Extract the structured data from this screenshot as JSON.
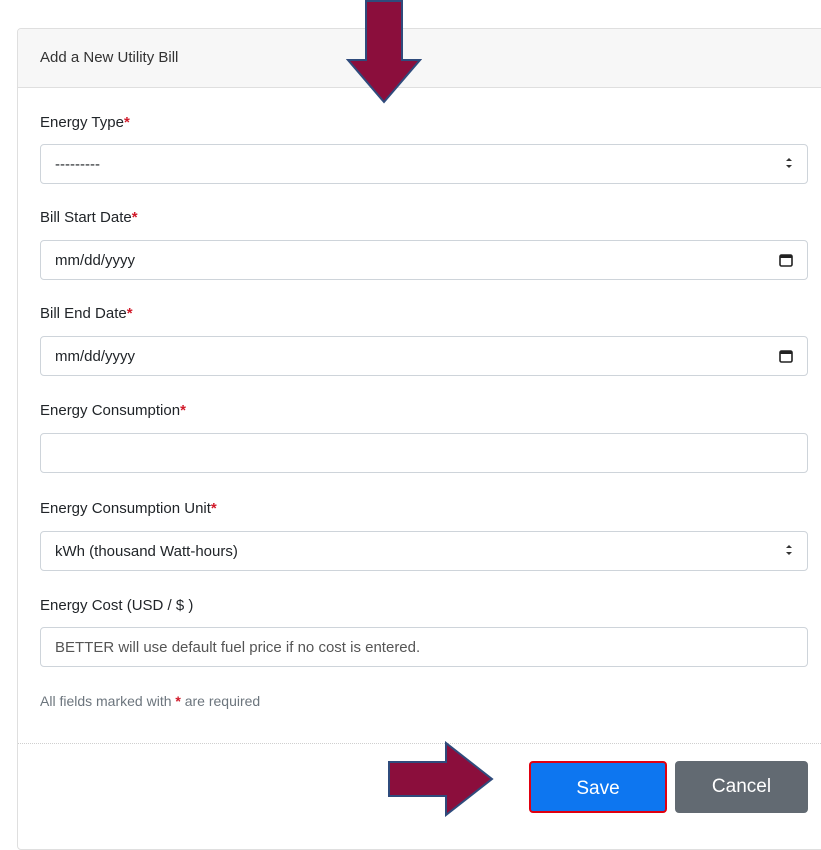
{
  "form": {
    "title": "Add a New Utility Bill",
    "fields": [
      {
        "label": "Energy Type",
        "required_mark": "*",
        "value": "---------",
        "placeholder": ""
      },
      {
        "label": "Bill Start Date",
        "required_mark": "*",
        "value": "mm/dd/yyyy",
        "placeholder": ""
      },
      {
        "label": "Bill End Date",
        "required_mark": "*",
        "value": "mm/dd/yyyy",
        "placeholder": ""
      },
      {
        "label": "Energy Consumption",
        "required_mark": "*",
        "value": "",
        "placeholder": ""
      },
      {
        "label": "Energy Consumption Unit",
        "required_mark": "*",
        "value": "kWh (thousand Watt-hours)",
        "placeholder": ""
      },
      {
        "label": "Energy Cost (USD / $ )",
        "required_mark": "",
        "value": "",
        "placeholder": "BETTER will use default fuel price if no cost is entered."
      }
    ],
    "required_note_prefix": "All fields marked with ",
    "required_note_mark": "*",
    "required_note_suffix": " are required"
  },
  "buttons": {
    "save_label": "Save",
    "cancel_label": "Cancel"
  },
  "colors": {
    "arrow": "#8b0e3c",
    "save_button": "#0d76f0",
    "save_outline": "#e00010",
    "cancel_button": "#626a72",
    "required_mark": "#d11a2a"
  },
  "icons": {
    "select_caret": "up-down-caret-icon",
    "calendar": "calendar-icon",
    "annotation_arrows": [
      "down-arrow-annotation",
      "right-arrow-annotation"
    ]
  }
}
